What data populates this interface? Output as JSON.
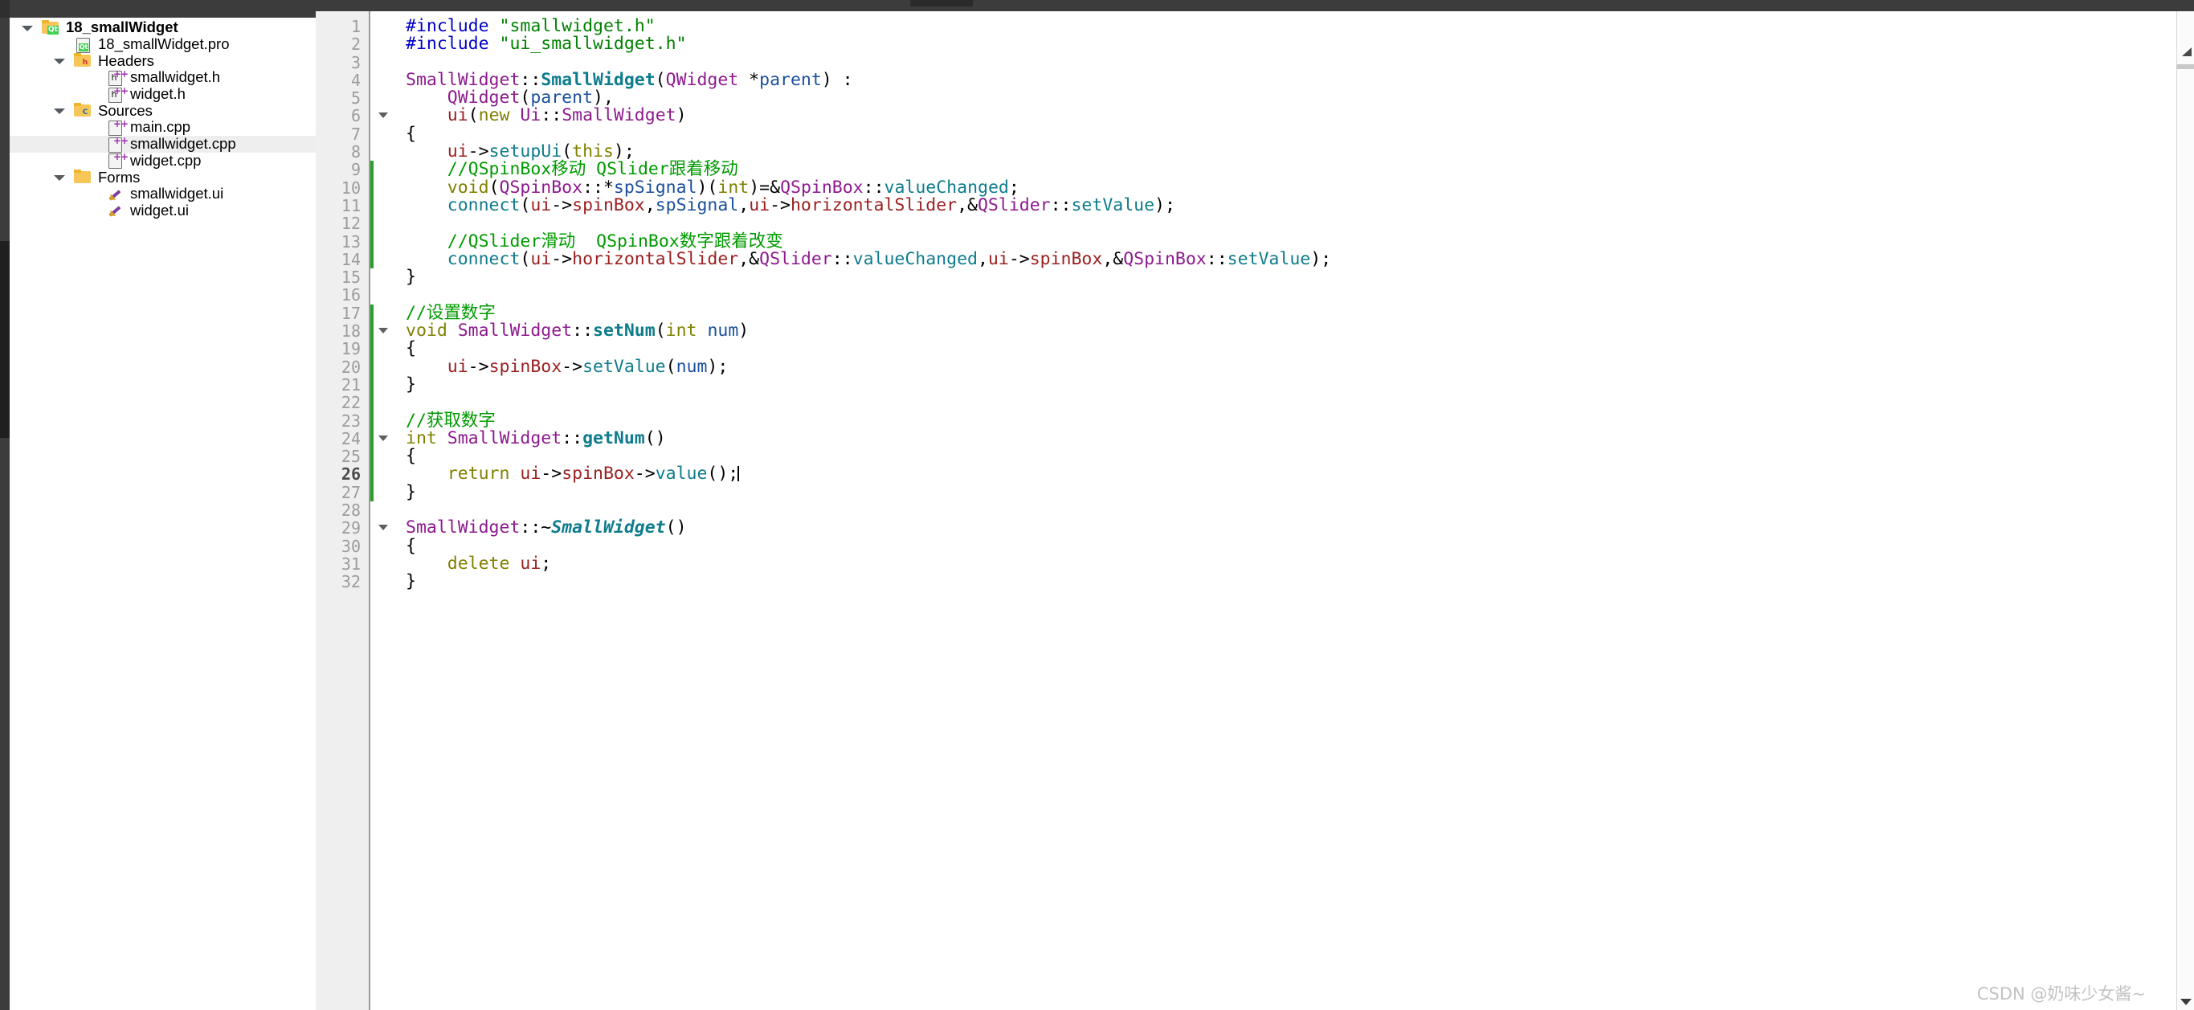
{
  "sidebar": {
    "name": "project-tree",
    "items": [
      {
        "label": "18_smallWidget",
        "indent": 0,
        "icon": "folder-qt-icon",
        "twisty": "open",
        "bold": true,
        "selected": false
      },
      {
        "label": "18_smallWidget.pro",
        "indent": 1,
        "icon": "file-qt-icon",
        "twisty": "none",
        "bold": false,
        "selected": false
      },
      {
        "label": "Headers",
        "indent": 1,
        "icon": "folder-h-icon",
        "twisty": "open",
        "bold": false,
        "selected": false
      },
      {
        "label": "smallwidget.h",
        "indent": 2,
        "icon": "file-h-icon",
        "twisty": "none",
        "bold": false,
        "selected": false
      },
      {
        "label": "widget.h",
        "indent": 2,
        "icon": "file-h-icon",
        "twisty": "none",
        "bold": false,
        "selected": false
      },
      {
        "label": "Sources",
        "indent": 1,
        "icon": "folder-cpp-icon",
        "twisty": "open",
        "bold": false,
        "selected": false
      },
      {
        "label": "main.cpp",
        "indent": 2,
        "icon": "file-cpp-icon",
        "twisty": "none",
        "bold": false,
        "selected": false
      },
      {
        "label": "smallwidget.cpp",
        "indent": 2,
        "icon": "file-cpp-icon",
        "twisty": "none",
        "bold": false,
        "selected": true
      },
      {
        "label": "widget.cpp",
        "indent": 2,
        "icon": "file-cpp-icon",
        "twisty": "none",
        "bold": false,
        "selected": false
      },
      {
        "label": "Forms",
        "indent": 1,
        "icon": "folder-ui-icon",
        "twisty": "open",
        "bold": false,
        "selected": false
      },
      {
        "label": "smallwidget.ui",
        "indent": 2,
        "icon": "file-ui-icon",
        "twisty": "none",
        "bold": false,
        "selected": false
      },
      {
        "label": "widget.ui",
        "indent": 2,
        "icon": "file-ui-icon",
        "twisty": "none",
        "bold": false,
        "selected": false
      }
    ]
  },
  "editor": {
    "name": "code-editor",
    "current_line": 26,
    "caret_line": 26,
    "fold_markers": [
      6,
      18,
      24,
      29
    ],
    "change_bar_lines": [
      9,
      10,
      11,
      12,
      13,
      14,
      17,
      18,
      19,
      20,
      21,
      22,
      23,
      24,
      25,
      26,
      27
    ],
    "colors": {
      "preprocessor": "#0000c8",
      "string": "#008000",
      "comment": "#009a00",
      "class": "#8e1a8e",
      "function": "#0e7c8c",
      "keyword": "#808000",
      "member": "#9c2020",
      "local": "#1a4f9c",
      "gutter_bg": "#efefef",
      "change_bar": "#2aa02a",
      "selection_bg": "#eeeeee"
    },
    "lines": [
      {
        "n": 1,
        "text": "#include \"smallwidget.h\""
      },
      {
        "n": 2,
        "text": "#include \"ui_smallwidget.h\""
      },
      {
        "n": 3,
        "text": ""
      },
      {
        "n": 4,
        "text": "SmallWidget::SmallWidget(QWidget *parent) :"
      },
      {
        "n": 5,
        "text": "    QWidget(parent),"
      },
      {
        "n": 6,
        "text": "    ui(new Ui::SmallWidget)"
      },
      {
        "n": 7,
        "text": "{"
      },
      {
        "n": 8,
        "text": "    ui->setupUi(this);"
      },
      {
        "n": 9,
        "text": "    //QSpinBox移动 QSlider跟着移动"
      },
      {
        "n": 10,
        "text": "    void(QSpinBox::*spSignal)(int)=&QSpinBox::valueChanged;"
      },
      {
        "n": 11,
        "text": "    connect(ui->spinBox,spSignal,ui->horizontalSlider,&QSlider::setValue);"
      },
      {
        "n": 12,
        "text": ""
      },
      {
        "n": 13,
        "text": "    //QSlider滑动  QSpinBox数字跟着改变"
      },
      {
        "n": 14,
        "text": "    connect(ui->horizontalSlider,&QSlider::valueChanged,ui->spinBox,&QSpinBox::setValue);"
      },
      {
        "n": 15,
        "text": "}"
      },
      {
        "n": 16,
        "text": ""
      },
      {
        "n": 17,
        "text": "//设置数字"
      },
      {
        "n": 18,
        "text": "void SmallWidget::setNum(int num)"
      },
      {
        "n": 19,
        "text": "{"
      },
      {
        "n": 20,
        "text": "    ui->spinBox->setValue(num);"
      },
      {
        "n": 21,
        "text": "}"
      },
      {
        "n": 22,
        "text": ""
      },
      {
        "n": 23,
        "text": "//获取数字"
      },
      {
        "n": 24,
        "text": "int SmallWidget::getNum()"
      },
      {
        "n": 25,
        "text": "{"
      },
      {
        "n": 26,
        "text": "    return ui->spinBox->value();"
      },
      {
        "n": 27,
        "text": "}"
      },
      {
        "n": 28,
        "text": ""
      },
      {
        "n": 29,
        "text": "SmallWidget::~SmallWidget()"
      },
      {
        "n": 30,
        "text": "{"
      },
      {
        "n": 31,
        "text": "    delete ui;"
      },
      {
        "n": 32,
        "text": "}"
      }
    ]
  },
  "watermark": {
    "text": "CSDN @奶味少女酱~"
  },
  "scrollbar": {
    "vertical_name": "editor-vertical-scrollbar",
    "left_rail_name": "sidebar-vertical-scrollbar"
  }
}
